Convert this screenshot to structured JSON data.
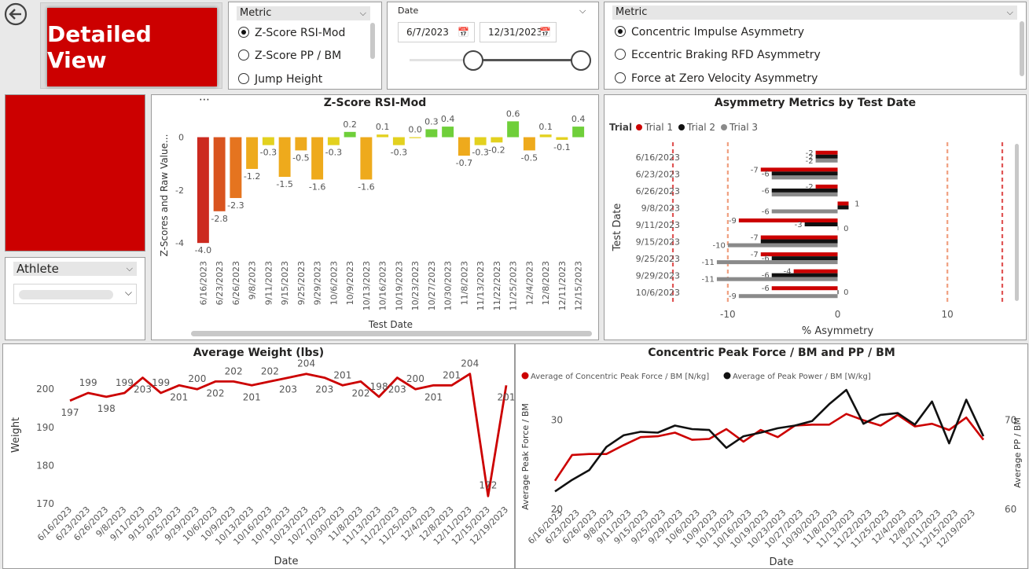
{
  "nav": {
    "back_icon": "back-arrow-icon"
  },
  "detailed_view": {
    "label": "Detailed View",
    "color": "#cc0000"
  },
  "metric_slicer": {
    "header": "Metric",
    "options": [
      {
        "label": "Z-Score RSI-Mod",
        "selected": true
      },
      {
        "label": "Z-Score PP / BM",
        "selected": false
      },
      {
        "label": "Jump Height",
        "selected": false
      }
    ]
  },
  "date_slicer": {
    "header": "Date",
    "start": "6/7/2023",
    "end": "12/31/2023"
  },
  "metric2_slicer": {
    "header": "Metric",
    "options": [
      {
        "label": "Concentric Impulse Asymmetry",
        "selected": true
      },
      {
        "label": "Eccentric Braking RFD Asymmetry",
        "selected": false
      },
      {
        "label": "Force at Zero Velocity Asymmetry",
        "selected": false
      }
    ]
  },
  "athlete_slicer": {
    "header": "Athlete"
  },
  "zscore_chart": {
    "more_icon": "more-options-icon"
  },
  "chart_data": [
    {
      "type": "bar",
      "title": "Z-Score RSI-Mod",
      "xlabel": "Test Date",
      "ylabel": "Z-Scores and Raw Value...",
      "ylim": [
        -4.5,
        0.7
      ],
      "yticks": [
        0,
        -2,
        -4
      ],
      "categories": [
        "6/16/2023",
        "6/23/2023",
        "6/26/2023",
        "9/8/2023",
        "9/11/2023",
        "9/15/2023",
        "9/25/2023",
        "9/29/2023",
        "10/6/2023",
        "10/9/2023",
        "10/13/2023",
        "10/16/2023",
        "10/19/2023",
        "10/23/2023",
        "10/27/2023",
        "10/30/2023",
        "11/8/2023",
        "11/13/2023",
        "11/22/2023",
        "11/25/2023",
        "12/4/2023",
        "12/8/2023",
        "12/11/2023",
        "12/15/2023"
      ],
      "values": [
        -4.0,
        -2.8,
        -2.3,
        -1.2,
        -0.3,
        -1.5,
        -0.5,
        -1.6,
        -0.3,
        0.2,
        -1.6,
        0.1,
        -0.3,
        0.0,
        0.3,
        0.4,
        -0.7,
        -0.3,
        -0.2,
        0.6,
        -0.5,
        0.1,
        -0.1,
        0.4
      ],
      "labels": [
        "-4.0",
        "-2.8",
        "-2.3",
        "-1.2",
        "-0.3",
        "-1.5",
        "-0.5",
        "-1.6",
        "-0.3",
        "0.2",
        "-1.6",
        "0.1",
        "-0.3",
        "0.0",
        "0.3",
        "0.4",
        "-0.7",
        "-0.3",
        "-0.2",
        "0.6",
        "-0.5",
        "0.1",
        "-0.1",
        "0.4"
      ]
    },
    {
      "type": "bar",
      "orientation": "horizontal",
      "title": "Asymmetry Metrics by Test Date",
      "xlabel": "% Asymmetry",
      "ylabel": "Test Date",
      "legend_title": "Trial",
      "xlim": [
        -14,
        16
      ],
      "xticks": [
        -10,
        0,
        10
      ],
      "categories": [
        "6/16/2023",
        "6/23/2023",
        "6/26/2023",
        "9/8/2023",
        "9/11/2023",
        "9/15/2023",
        "9/25/2023",
        "9/29/2023",
        "10/6/2023"
      ],
      "series": [
        {
          "name": "Trial 1",
          "color": "#cc0000",
          "values": [
            -2,
            -7,
            -2,
            1,
            -9,
            -7,
            -7,
            -4,
            -6
          ]
        },
        {
          "name": "Trial 2",
          "color": "#111111",
          "values": [
            -2,
            -6,
            -6,
            1,
            -3,
            -7,
            -6,
            -6,
            0
          ]
        },
        {
          "name": "Trial 3",
          "color": "#8a8a8a",
          "values": [
            -2,
            -6,
            -6,
            -6,
            0,
            -10,
            -11,
            -11,
            -9
          ]
        }
      ],
      "label_values": [
        [
          "-2",
          "-7",
          "-2",
          "1",
          "-9",
          "-7",
          "-7",
          "-4",
          "-6"
        ],
        [
          "-2",
          "-6",
          "-6",
          "",
          "-3",
          "",
          "-6",
          "-6",
          "0"
        ],
        [
          "-2",
          "",
          "",
          "-6",
          "0",
          "-10",
          "-11",
          "-11",
          "-9"
        ]
      ],
      "reference_lines": [
        -15,
        -10,
        10,
        15
      ]
    },
    {
      "type": "line",
      "title": "Average Weight (lbs)",
      "xlabel": "Date",
      "ylabel": "Weight",
      "ylim": [
        170,
        206
      ],
      "yticks": [
        200,
        190,
        180,
        170
      ],
      "x": [
        "6/16/2023",
        "6/23/2023",
        "6/26/2023",
        "9/8/2023",
        "9/11/2023",
        "9/15/2023",
        "9/25/2023",
        "9/29/2023",
        "10/6/2023",
        "10/9/2023",
        "10/13/2023",
        "10/16/2023",
        "10/19/2023",
        "10/23/2023",
        "10/27/2023",
        "10/30/2023",
        "11/8/2023",
        "11/13/2023",
        "11/22/2023",
        "11/25/2023",
        "12/4/2023",
        "12/8/2023",
        "12/11/2023",
        "12/15/2023",
        "12/19/2023"
      ],
      "series": [
        {
          "color": "#cc0000",
          "values": [
            197,
            199,
            198,
            199,
            203,
            199,
            201,
            200,
            202,
            202,
            201,
            202,
            203,
            204,
            203,
            201,
            202,
            198,
            203,
            200,
            201,
            201,
            204,
            172,
            201
          ]
        }
      ]
    },
    {
      "type": "line",
      "title": "Concentric Peak Force / BM and PP / BM",
      "xlabel": "Date",
      "ylabel": "Average Peak Force / BM",
      "y2label": "Average PP / BM",
      "ylim": [
        20,
        35
      ],
      "y2lim": [
        60,
        75
      ],
      "yticks": [
        30,
        20
      ],
      "y2ticks": [
        70,
        60
      ],
      "x": [
        "6/16/2023",
        "6/23/2023",
        "6/26/2023",
        "9/8/2023",
        "9/11/2023",
        "9/15/2023",
        "9/25/2023",
        "9/29/2023",
        "10/6/2023",
        "10/9/2023",
        "10/13/2023",
        "10/16/2023",
        "10/19/2023",
        "10/23/2023",
        "10/27/2023",
        "10/30/2023",
        "11/8/2023",
        "11/13/2023",
        "11/22/2023",
        "11/25/2023",
        "12/4/2023",
        "12/8/2023",
        "12/11/2023",
        "12/15/2023",
        "12/19/2023"
      ],
      "series": [
        {
          "name": "Average of Concentric Peak Force / BM [N/kg]",
          "color": "#cc0000",
          "axis": "left",
          "values": [
            23.2,
            26.1,
            26.2,
            26.2,
            27.2,
            28.1,
            28.2,
            28.6,
            27.8,
            27.9,
            29.0,
            27.6,
            28.9,
            28.1,
            29.4,
            29.5,
            29.5,
            30.7,
            30.0,
            29.4,
            30.6,
            29.3,
            29.6,
            28.9,
            30.3,
            27.8
          ]
        },
        {
          "name": "Average of Peak Power / BM [W/kg]",
          "color": "#111111",
          "axis": "right",
          "values": [
            62.0,
            63.3,
            64.4,
            67.0,
            68.3,
            68.7,
            68.6,
            69.4,
            69.0,
            68.9,
            66.9,
            68.2,
            68.6,
            69.1,
            69.4,
            69.9,
            71.8,
            73.4,
            69.6,
            70.6,
            70.8,
            69.5,
            72.1,
            67.4,
            72.3,
            68.2
          ]
        }
      ]
    }
  ]
}
